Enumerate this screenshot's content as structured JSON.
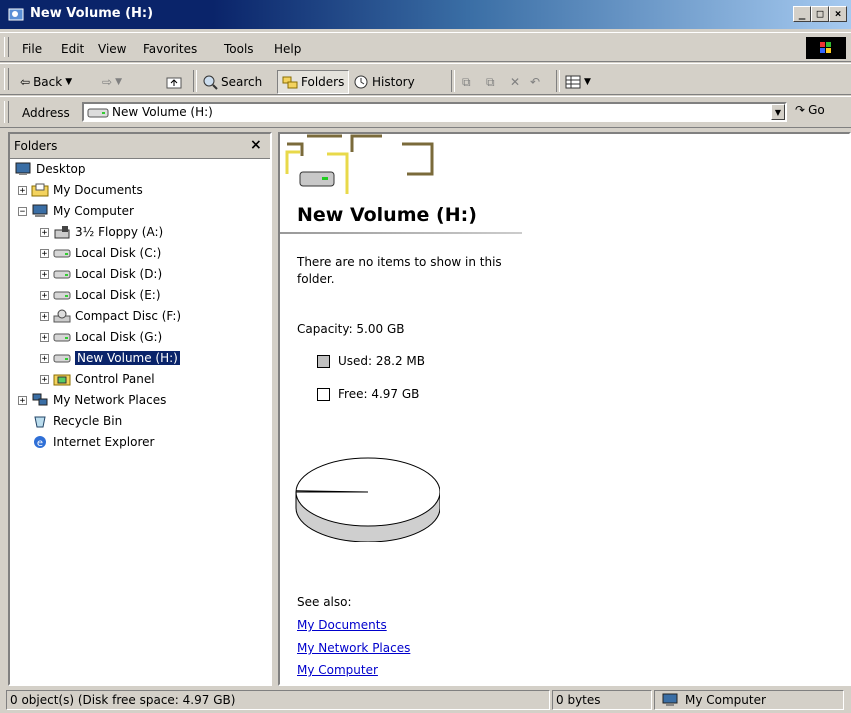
{
  "window": {
    "title": "New Volume (H:)"
  },
  "caption_buttons": {
    "minimize": "_",
    "maximize": "□",
    "close": "×"
  },
  "menu": [
    "File",
    "Edit",
    "View",
    "Favorites",
    "Tools",
    "Help"
  ],
  "toolbar": {
    "back": "Back",
    "search": "Search",
    "folders": "Folders",
    "history": "History"
  },
  "address": {
    "label": "Address",
    "value": "New Volume (H:)",
    "go": "Go"
  },
  "folders_pane": {
    "title": "Folders",
    "close": "×",
    "tree": [
      {
        "label": "Desktop",
        "icon": "desktop-icon"
      },
      {
        "label": "My Documents",
        "icon": "my-documents-icon"
      },
      {
        "label": "My Computer",
        "icon": "my-computer-icon"
      },
      {
        "label": "3½ Floppy (A:)",
        "icon": "floppy-icon"
      },
      {
        "label": "Local Disk (C:)",
        "icon": "drive-icon"
      },
      {
        "label": "Local Disk (D:)",
        "icon": "drive-icon"
      },
      {
        "label": "Local Disk (E:)",
        "icon": "drive-icon"
      },
      {
        "label": "Compact Disc (F:)",
        "icon": "cd-icon"
      },
      {
        "label": "Local Disk (G:)",
        "icon": "drive-icon"
      },
      {
        "label": "New Volume (H:)",
        "icon": "drive-icon",
        "selected": true
      },
      {
        "label": "Control Panel",
        "icon": "control-panel-icon"
      },
      {
        "label": "My Network Places",
        "icon": "network-icon"
      },
      {
        "label": "Recycle Bin",
        "icon": "recycle-bin-icon"
      },
      {
        "label": "Internet Explorer",
        "icon": "ie-icon"
      }
    ]
  },
  "content": {
    "heading": "New Volume (H:)",
    "empty_message": "There are no items to show in this folder.",
    "capacity": "Capacity: 5.00 GB",
    "used": "Used: 28.2 MB",
    "free": "Free: 4.97 GB",
    "used_fraction": 0.0055,
    "see_also": "See also:",
    "links": [
      "My Documents",
      "My Network Places",
      "My Computer"
    ]
  },
  "status": {
    "objects": "0 object(s) (Disk free space: 4.97 GB)",
    "size": "0 bytes",
    "zone": "My Computer"
  },
  "colors": {
    "titlebar": "#0a246a",
    "selection": "#0a246a",
    "link": "#0000cc",
    "used_swatch": "#c0c0c0"
  }
}
